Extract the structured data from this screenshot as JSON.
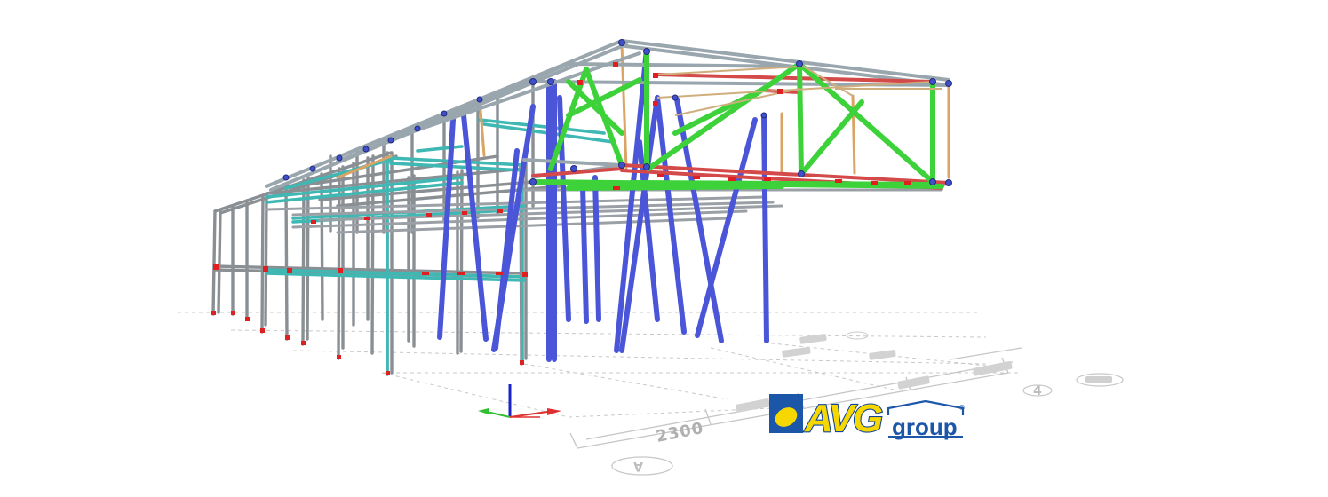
{
  "viewport": {
    "dimension_label": "2300",
    "grid_label_bottom": "A",
    "grid_label_right": "4"
  },
  "logo": {
    "brand": "AVG",
    "suffix": "group",
    "registered": "®"
  },
  "colors": {
    "grey_frame": "#8a8f94",
    "teal_beam": "#3fb8b4",
    "blue_column": "#4a55d8",
    "green_truss": "#3ed23a",
    "red_chord": "#d44a4a",
    "tan_member": "#d9b27a",
    "brand_blue": "#1c56a8",
    "brand_yellow": "#f6d800"
  },
  "icons": [
    "axis-triad-icon",
    "avg-logo-icon"
  ]
}
